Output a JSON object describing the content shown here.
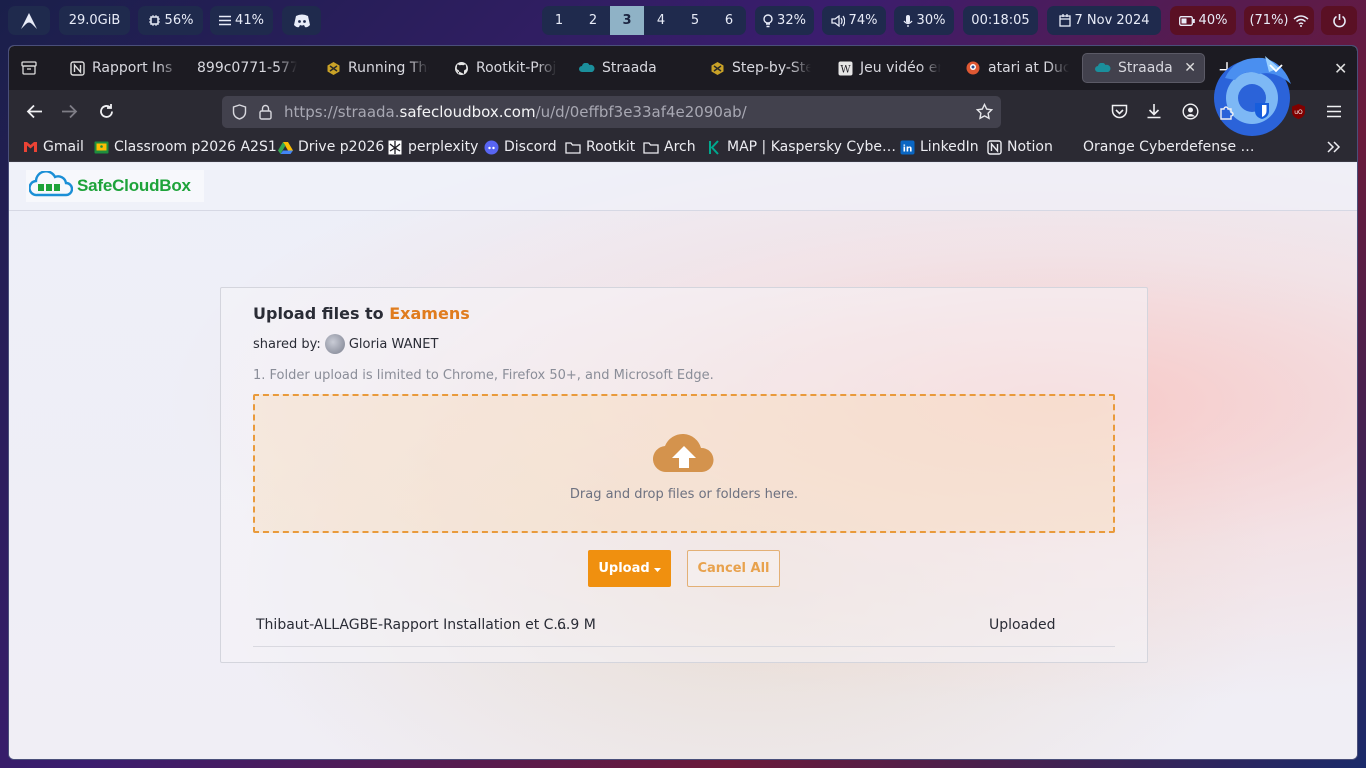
{
  "system_bar": {
    "memory": "29.0GiB",
    "cpu": "56%",
    "load": "41%",
    "workspaces": [
      "1",
      "2",
      "3",
      "4",
      "5",
      "6"
    ],
    "active_workspace": "3",
    "brightness": "32%",
    "volume": "74%",
    "mic": "30%",
    "time": "00:18:05",
    "date": "7 Nov 2024",
    "battery": "40%",
    "wifi": "(71%)"
  },
  "browser": {
    "tabs": [
      {
        "label": "Rapport Ins",
        "icon": "notion-icon"
      },
      {
        "label": "899c0771-577",
        "icon": "none"
      },
      {
        "label": "Running The",
        "icon": "hex-icon"
      },
      {
        "label": "Rootkit-Proj",
        "icon": "github-icon"
      },
      {
        "label": "Straada",
        "icon": "cloud-icon"
      },
      {
        "label": "Step-by-Ste",
        "icon": "hex-icon"
      },
      {
        "label": "Jeu vidéo en",
        "icon": "wikipedia-icon"
      },
      {
        "label": "atari at Duc",
        "icon": "duck-icon"
      },
      {
        "label": "Straada",
        "icon": "cloud-icon",
        "active": true
      }
    ],
    "url_prefix": "https://straada.",
    "url_host": "safecloudbox.com",
    "url_path": "/u/d/0effbf3e33af4e2090ab/",
    "bookmarks": [
      "Gmail",
      "Classroom p2026 A2S1",
      "Drive p2026",
      "perplexity",
      "Discord",
      "Rootkit",
      "Arch",
      "MAP | Kaspersky Cybe…",
      "LinkedIn",
      "Notion",
      "Orange Cyberdefense …"
    ]
  },
  "site": {
    "logo_text": "SafeCloudBox",
    "upload_title_prefix": "Upload files to ",
    "folder_name": "Examens",
    "shared_by_label": "shared by:",
    "shared_by_user": "Gloria WANET",
    "note": "1. Folder upload is limited to Chrome, Firefox 50+, and Microsoft Edge.",
    "drop_text": "Drag and drop files or folders here.",
    "upload_button": "Upload",
    "cancel_button": "Cancel All",
    "files": [
      {
        "name": "Thibaut-ALLAGBE-Rapport Installation et C...",
        "size": "6.9 M",
        "status": "Uploaded"
      }
    ]
  },
  "colors": {
    "accent_orange": "#f0900f",
    "folder_orange": "#e07c1e",
    "logo_green": "#1ea33a",
    "logo_blue": "#1b8fd6"
  }
}
